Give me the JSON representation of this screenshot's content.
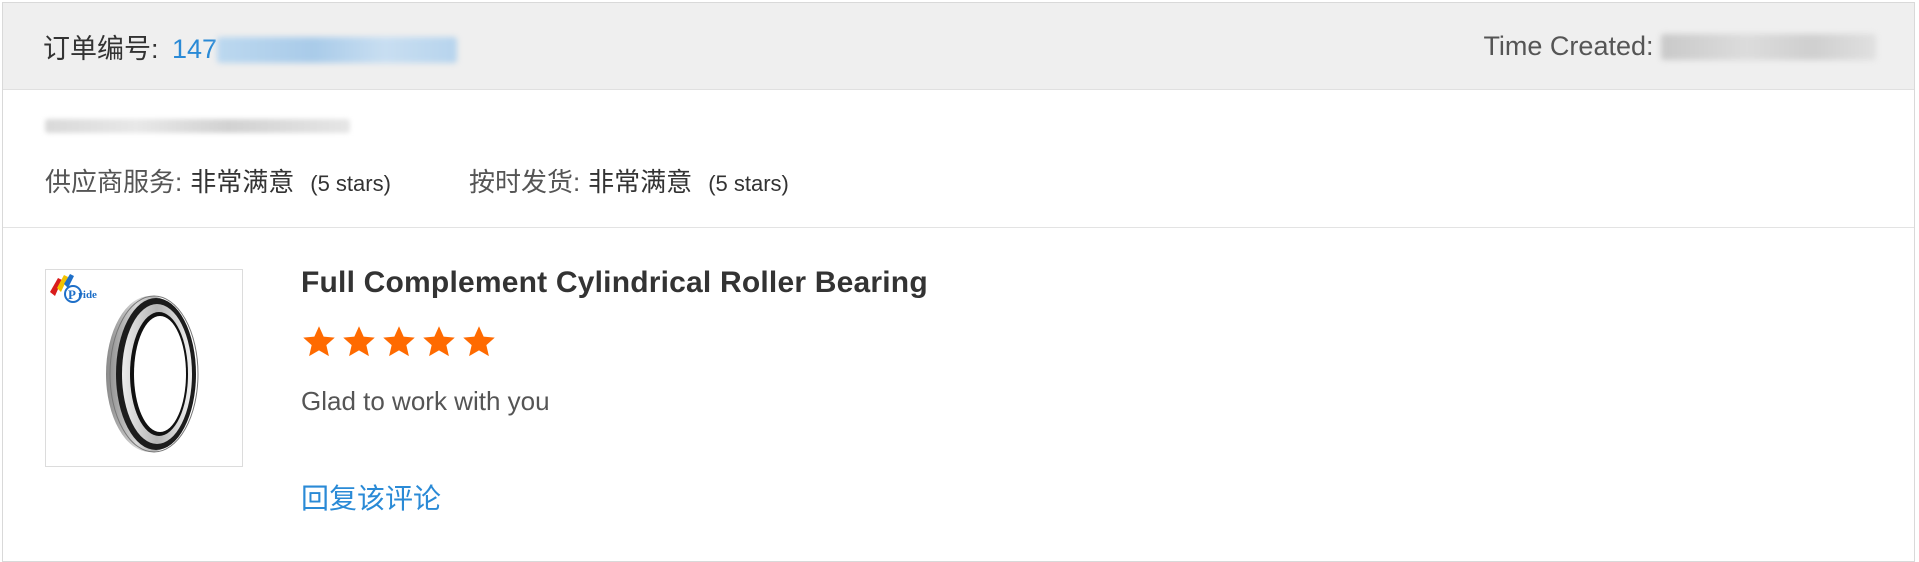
{
  "header": {
    "order_label": "订单编号: ",
    "order_number_visible": "147",
    "time_label": "Time Created: "
  },
  "ratings": {
    "supplier_service": {
      "label": "供应商服务:",
      "value": "非常满意",
      "stars": "(5 stars)"
    },
    "on_time_delivery": {
      "label": "按时发货:",
      "value": "非常满意",
      "stars": "(5 stars)"
    }
  },
  "product": {
    "title": "Full Complement Cylindrical Roller Bearing",
    "rating": 5,
    "comment": "Glad to work with you",
    "reply_label": "回复该评论",
    "logo_text": "Pride"
  },
  "colors": {
    "link": "#2a8ad6",
    "star": "#ff6a00",
    "header_bg": "#efefef"
  }
}
